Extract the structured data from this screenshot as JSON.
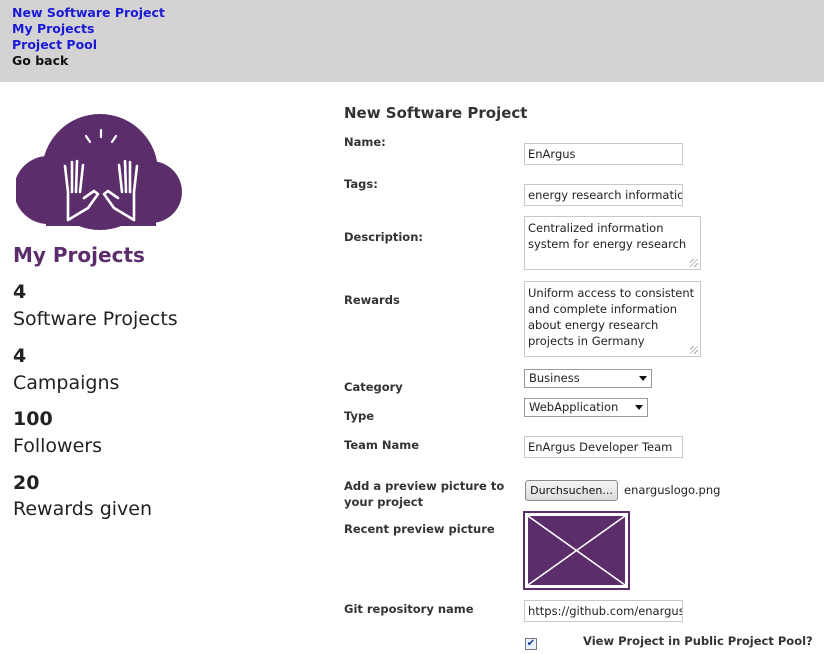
{
  "nav": {
    "new_project": "New Software Project",
    "my_projects": "My Projects",
    "project_pool": "Project Pool",
    "go_back": "Go back"
  },
  "sidebar": {
    "title": "My Projects",
    "stats": [
      {
        "value": "4",
        "label": "Software Projects"
      },
      {
        "value": "4",
        "label": "Campaigns"
      },
      {
        "value": "100",
        "label": "Followers"
      },
      {
        "value": "20",
        "label": "Rewards given"
      }
    ]
  },
  "form": {
    "title": "New Software Project",
    "name_label": "Name:",
    "name_value": "EnArgus",
    "tags_label": "Tags:",
    "tags_value": "energy research information",
    "description_label": "Description:",
    "description_value": "Centralized information system for energy research",
    "rewards_label": "Rewards",
    "rewards_value": "Uniform access to consistent and complete information about energy research projects in Germany",
    "category_label": "Category",
    "category_value": "Business",
    "type_label": "Type",
    "type_value": "WebApplication",
    "team_label": "Team Name",
    "team_value": "EnArgus Developer Team",
    "preview_upload_label": "Add a preview picture to your project",
    "browse_button": "Durchsuchen...",
    "preview_filename": "enarguslogo.png",
    "recent_preview_label": "Recent preview picture",
    "git_label": "Git repository name",
    "git_value": "https://github.com/enargus",
    "public_checked": true,
    "public_label": "View Project in Public Project Pool?"
  },
  "colors": {
    "brand_purple": "#5c2d6b",
    "link_blue": "#1a1ad6",
    "topbar_bg": "#d3d3d3"
  }
}
